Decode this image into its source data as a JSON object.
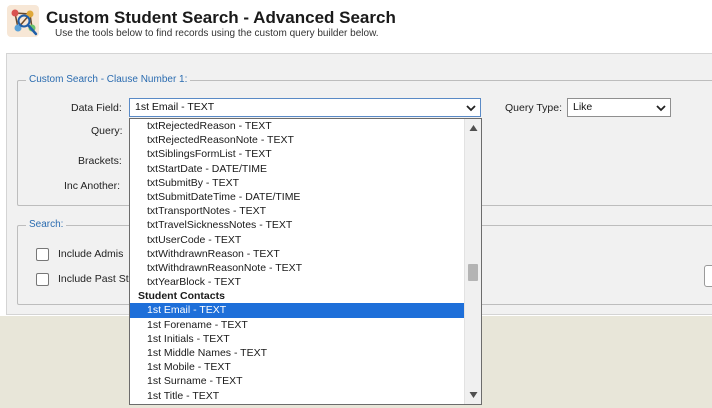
{
  "header": {
    "title": "Custom Student Search - Advanced Search",
    "subtitle": "Use the tools below to find records using the custom query builder below."
  },
  "clause": {
    "legend": "Custom Search - Clause Number 1:",
    "data_field_label": "Data Field:",
    "data_field_value": "1st Email - TEXT",
    "query_type_label": "Query Type:",
    "query_type_value": "Like",
    "query_label": "Query:",
    "brackets_label": "Brackets:",
    "inc_another_label": "Inc Another:"
  },
  "search": {
    "legend": "Search:",
    "option_1_label": "Include Admis",
    "option_2_label": "Include Past St"
  },
  "dropdown": {
    "items": [
      {
        "label": "txtRejectedReason - TEXT",
        "type": "option"
      },
      {
        "label": "txtRejectedReasonNote - TEXT",
        "type": "option"
      },
      {
        "label": "txtSiblingsFormList - TEXT",
        "type": "option"
      },
      {
        "label": "txtStartDate - DATE/TIME",
        "type": "option"
      },
      {
        "label": "txtSubmitBy - TEXT",
        "type": "option"
      },
      {
        "label": "txtSubmitDateTime - DATE/TIME",
        "type": "option"
      },
      {
        "label": "txtTransportNotes - TEXT",
        "type": "option"
      },
      {
        "label": "txtTravelSicknessNotes - TEXT",
        "type": "option"
      },
      {
        "label": "txtUserCode - TEXT",
        "type": "option"
      },
      {
        "label": "txtWithdrawnReason - TEXT",
        "type": "option"
      },
      {
        "label": "txtWithdrawnReasonNote - TEXT",
        "type": "option"
      },
      {
        "label": "txtYearBlock - TEXT",
        "type": "option"
      },
      {
        "label": "Student Contacts",
        "type": "group"
      },
      {
        "label": "1st Email - TEXT",
        "type": "option",
        "selected": true
      },
      {
        "label": "1st Forename - TEXT",
        "type": "option"
      },
      {
        "label": "1st Initials - TEXT",
        "type": "option"
      },
      {
        "label": "1st Middle Names - TEXT",
        "type": "option"
      },
      {
        "label": "1st Mobile - TEXT",
        "type": "option"
      },
      {
        "label": "1st Surname - TEXT",
        "type": "option"
      },
      {
        "label": "1st Title - TEXT",
        "type": "option"
      }
    ]
  },
  "colors": {
    "accent": "#2b6cb0",
    "selection": "#1e6fd9",
    "panel": "#f1f1f1",
    "footer": "#e8e6d9"
  },
  "icons": {
    "header": "network-search-icon",
    "chevron": "chevron-down-icon"
  }
}
